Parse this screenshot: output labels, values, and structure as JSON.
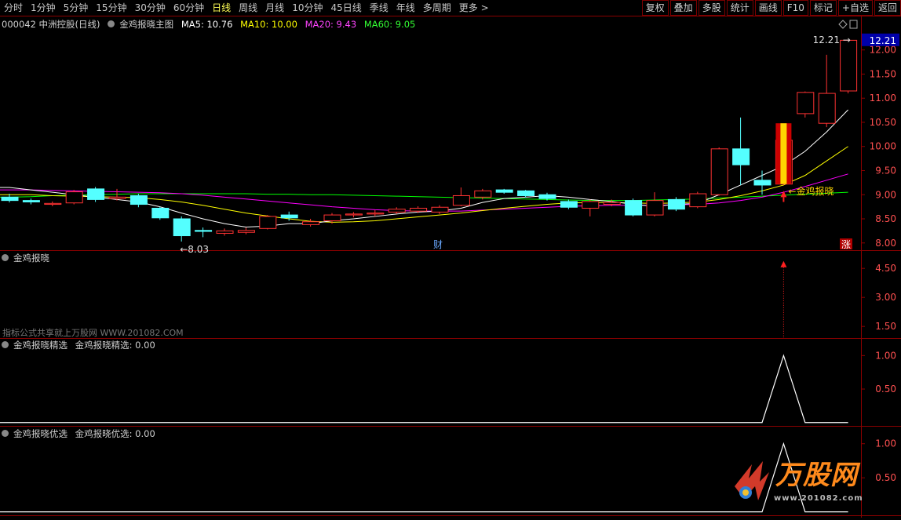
{
  "toolbar": {
    "periods": [
      "分时",
      "1分钟",
      "5分钟",
      "15分钟",
      "30分钟",
      "60分钟",
      "日线",
      "周线",
      "月线",
      "10分钟",
      "45日线",
      "季线",
      "年线",
      "多周期",
      "更多 >"
    ],
    "active_period": "日线",
    "buttons": [
      "复权",
      "叠加",
      "多股",
      "统计",
      "画线",
      "F10",
      "标记",
      "+自选",
      "返回"
    ]
  },
  "main_panel": {
    "stock": "000042 中洲控股(日线)",
    "indicator": "金鸡报晓主图",
    "ma5": "MA5: 10.76",
    "ma10": "MA10: 10.00",
    "ma20": "MA20: 9.43",
    "ma60": "MA60: 9.05",
    "price_tag": "12.21",
    "high_label": "12.21",
    "low_label": "8.03",
    "signal_label": "金鸡报晓",
    "cai_badge": "财",
    "zhang_badge": "涨",
    "yticks": [
      "12.00",
      "11.50",
      "11.00",
      "10.50",
      "10.00",
      "9.50",
      "9.00",
      "8.50",
      "8.00"
    ]
  },
  "panel2": {
    "title": "金鸡报晓",
    "watermark": "指标公式共享就上万股网 WWW.201082.COM",
    "yticks": [
      "4.50",
      "3.00",
      "1.50"
    ]
  },
  "panel3": {
    "title": "金鸡报晓精选",
    "value": "金鸡报晓精选: 0.00",
    "yticks": [
      "1.00",
      "0.50"
    ]
  },
  "panel4": {
    "title": "金鸡报晓优选",
    "value": "金鸡报晓优选: 0.00",
    "yticks": [
      "1.00",
      "0.50"
    ]
  },
  "logo": {
    "text": "万股网",
    "url": "www.201082.com"
  },
  "colors": {
    "up": "#ff3232",
    "down": "#54ffff",
    "ma5": "#ffffff",
    "ma10": "#ffff00",
    "ma20": "#ff00ff",
    "ma60": "#00ff00",
    "grid": "#8b0000",
    "signal": "#ffd700"
  },
  "chart_data": {
    "type": "candlestick",
    "ylim": [
      7.85,
      12.45
    ],
    "candles": [
      {
        "o": 8.95,
        "c": 8.88,
        "h": 9.02,
        "l": 8.84
      },
      {
        "o": 8.88,
        "c": 8.85,
        "h": 8.92,
        "l": 8.8
      },
      {
        "o": 8.8,
        "c": 8.82,
        "h": 8.86,
        "l": 8.76
      },
      {
        "o": 8.83,
        "c": 9.06,
        "h": 9.1,
        "l": 8.8
      },
      {
        "o": 9.12,
        "c": 8.9,
        "h": 9.16,
        "l": 8.85
      },
      {
        "o": 8.92,
        "c": 8.95,
        "h": 9.12,
        "l": 8.88
      },
      {
        "o": 8.98,
        "c": 8.8,
        "h": 9.02,
        "l": 8.74
      },
      {
        "o": 8.72,
        "c": 8.52,
        "h": 8.75,
        "l": 8.48
      },
      {
        "o": 8.5,
        "c": 8.15,
        "h": 8.55,
        "l": 8.03
      },
      {
        "o": 8.26,
        "c": 8.24,
        "h": 8.32,
        "l": 8.12
      },
      {
        "o": 8.2,
        "c": 8.25,
        "h": 8.3,
        "l": 8.15
      },
      {
        "o": 8.22,
        "c": 8.26,
        "h": 8.32,
        "l": 8.18
      },
      {
        "o": 8.3,
        "c": 8.55,
        "h": 8.58,
        "l": 8.28
      },
      {
        "o": 8.58,
        "c": 8.52,
        "h": 8.65,
        "l": 8.46
      },
      {
        "o": 8.38,
        "c": 8.44,
        "h": 8.5,
        "l": 8.34
      },
      {
        "o": 8.46,
        "c": 8.58,
        "h": 8.62,
        "l": 8.4
      },
      {
        "o": 8.58,
        "c": 8.6,
        "h": 8.64,
        "l": 8.53
      },
      {
        "o": 8.6,
        "c": 8.62,
        "h": 8.68,
        "l": 8.55
      },
      {
        "o": 8.64,
        "c": 8.7,
        "h": 8.74,
        "l": 8.6
      },
      {
        "o": 8.66,
        "c": 8.72,
        "h": 8.76,
        "l": 8.62
      },
      {
        "o": 8.64,
        "c": 8.74,
        "h": 8.78,
        "l": 8.6
      },
      {
        "o": 8.78,
        "c": 8.98,
        "h": 9.15,
        "l": 8.76
      },
      {
        "o": 8.95,
        "c": 9.08,
        "h": 9.12,
        "l": 8.9
      },
      {
        "o": 9.1,
        "c": 9.05,
        "h": 9.12,
        "l": 9.02
      },
      {
        "o": 9.08,
        "c": 8.98,
        "h": 9.1,
        "l": 8.94
      },
      {
        "o": 9.0,
        "c": 8.92,
        "h": 9.04,
        "l": 8.88
      },
      {
        "o": 8.86,
        "c": 8.74,
        "h": 8.9,
        "l": 8.7
      },
      {
        "o": 8.72,
        "c": 8.86,
        "h": 8.9,
        "l": 8.55
      },
      {
        "o": 8.8,
        "c": 8.84,
        "h": 8.9,
        "l": 8.76
      },
      {
        "o": 8.88,
        "c": 8.58,
        "h": 8.92,
        "l": 8.55
      },
      {
        "o": 8.58,
        "c": 8.88,
        "h": 9.05,
        "l": 8.55
      },
      {
        "o": 8.9,
        "c": 8.7,
        "h": 8.95,
        "l": 8.66
      },
      {
        "o": 8.75,
        "c": 9.02,
        "h": 9.06,
        "l": 8.72
      },
      {
        "o": 9.0,
        "c": 9.95,
        "h": 9.98,
        "l": 8.98
      },
      {
        "o": 9.95,
        "c": 9.62,
        "h": 10.6,
        "l": 9.2
      },
      {
        "o": 9.3,
        "c": 9.2,
        "h": 9.5,
        "l": 9.0
      },
      {
        "o": 9.22,
        "c": 10.13,
        "h": 10.15,
        "l": 9.2
      },
      {
        "o": 10.68,
        "c": 11.12,
        "h": 11.14,
        "l": 10.6
      },
      {
        "o": 10.48,
        "c": 11.1,
        "h": 11.9,
        "l": 10.4
      },
      {
        "o": 11.15,
        "c": 12.2,
        "h": 12.21,
        "l": 11.1
      }
    ],
    "ma5": [
      9.15,
      9.1,
      9.05,
      9.0,
      8.95,
      8.9,
      8.85,
      8.75,
      8.62,
      8.5,
      8.4,
      8.33,
      8.35,
      8.4,
      8.4,
      8.46,
      8.5,
      8.55,
      8.6,
      8.64,
      8.66,
      8.72,
      8.84,
      8.92,
      8.95,
      8.98,
      8.95,
      8.9,
      8.86,
      8.8,
      8.76,
      8.8,
      8.82,
      9.0,
      9.2,
      9.4,
      9.6,
      9.9,
      10.3,
      10.76
    ],
    "ma10": [
      9.0,
      9.0,
      8.98,
      8.97,
      8.96,
      8.95,
      8.94,
      8.9,
      8.85,
      8.78,
      8.7,
      8.62,
      8.56,
      8.5,
      8.45,
      8.43,
      8.44,
      8.46,
      8.5,
      8.54,
      8.58,
      8.62,
      8.67,
      8.72,
      8.76,
      8.8,
      8.83,
      8.84,
      8.84,
      8.83,
      8.82,
      8.83,
      8.85,
      8.9,
      8.98,
      9.08,
      9.2,
      9.4,
      9.7,
      10.0
    ],
    "ma20": [
      9.1,
      9.1,
      9.09,
      9.08,
      9.07,
      9.06,
      9.05,
      9.04,
      9.02,
      8.99,
      8.95,
      8.91,
      8.87,
      8.83,
      8.79,
      8.75,
      8.72,
      8.69,
      8.67,
      8.66,
      8.66,
      8.66,
      8.68,
      8.7,
      8.72,
      8.74,
      8.76,
      8.77,
      8.78,
      8.78,
      8.78,
      8.79,
      8.8,
      8.83,
      8.88,
      8.95,
      9.05,
      9.17,
      9.3,
      9.43
    ],
    "ma60": [
      8.95,
      8.96,
      8.98,
      8.99,
      9.0,
      9.01,
      9.02,
      9.02,
      9.02,
      9.02,
      9.02,
      9.02,
      9.01,
      9.01,
      9.0,
      9.0,
      8.99,
      8.98,
      8.97,
      8.96,
      8.95,
      8.94,
      8.93,
      8.92,
      8.91,
      8.9,
      8.89,
      8.88,
      8.88,
      8.88,
      8.89,
      8.9,
      8.91,
      8.93,
      8.95,
      8.97,
      8.99,
      9.01,
      9.03,
      9.05
    ],
    "signal_index": 36,
    "panel2_spike": {
      "index": 36,
      "value": 4.8
    },
    "panel3_spike": {
      "index": 36,
      "value": 1.0
    },
    "panel4_spike": {
      "index": 36,
      "value": 1.0
    }
  }
}
